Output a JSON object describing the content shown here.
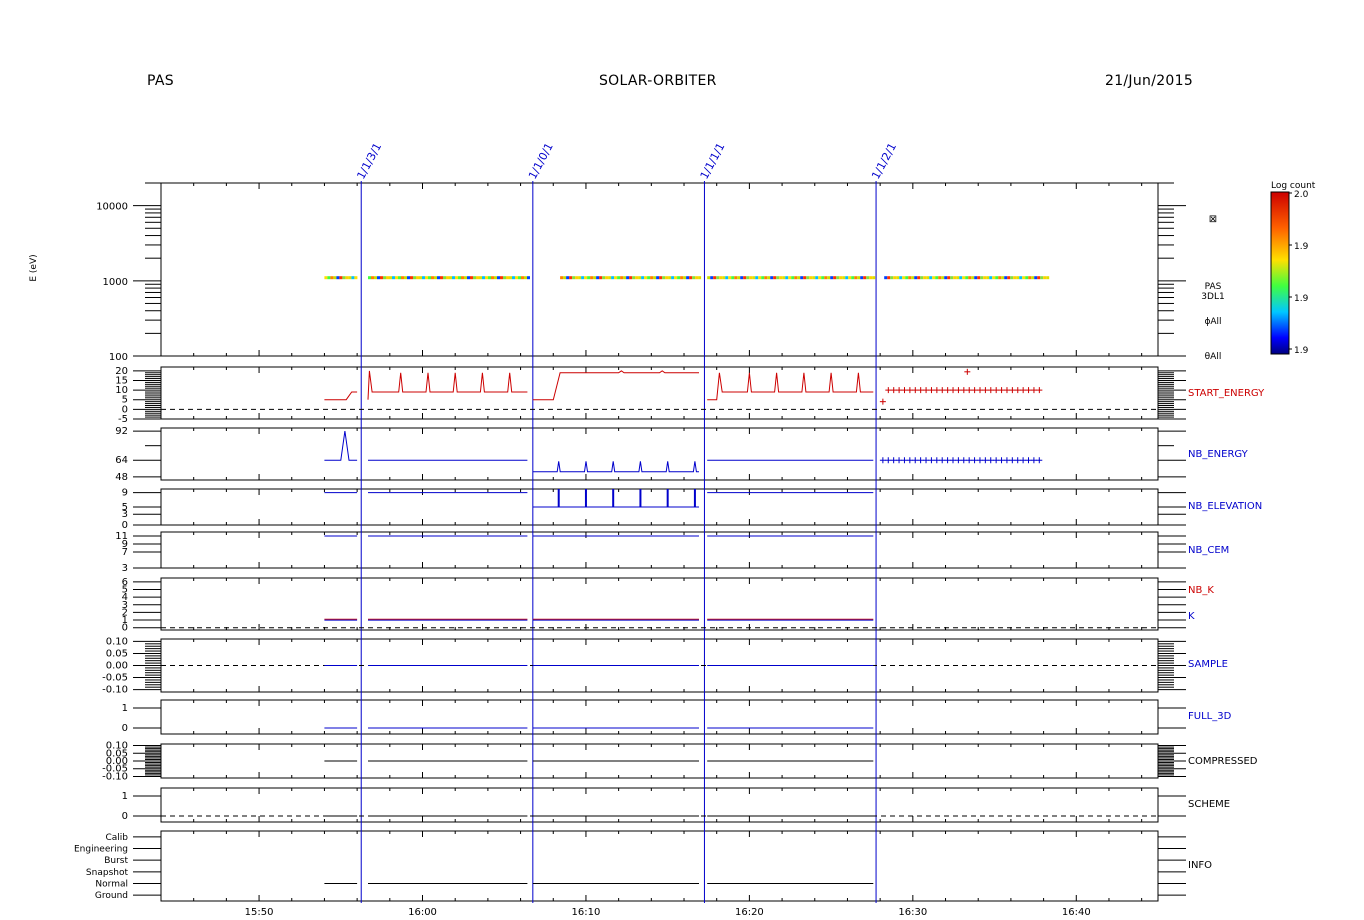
{
  "header": {
    "left": "PAS",
    "center": "SOLAR-ORBITER",
    "right": "21/Jun/2015"
  },
  "colors": {
    "blue": "#0000cc",
    "red": "#cc0000",
    "black": "#000000"
  },
  "chart_data": {
    "type": "line",
    "x_axis": {
      "range": [
        "15:44",
        "16:45"
      ],
      "ticks": [
        "15:50",
        "16:00",
        "16:10",
        "16:20",
        "16:30",
        "16:40"
      ]
    },
    "markers": [
      {
        "time": "15:56:15",
        "label": "1/1/3/1"
      },
      {
        "time": "16:06:45",
        "label": "1/1/0/1"
      },
      {
        "time": "16:17:15",
        "label": "1/1/1/1"
      },
      {
        "time": "16:27:45",
        "label": "1/1/2/1"
      }
    ],
    "spectrogram": {
      "ylabel": "E (eV)",
      "yscale": "log",
      "yticks": [
        "10000",
        "1000",
        "100"
      ],
      "ylim": [
        100,
        20000
      ],
      "right_labels": [
        "PAS",
        "3DL1",
        "ϕAll",
        "θAll"
      ],
      "colorbar": {
        "title": "Log count",
        "ticks": [
          "2.0",
          "1.9",
          "1.9",
          "1.9"
        ]
      },
      "energy_level": 1100,
      "segments": [
        [
          "15:54:00",
          "15:56:00"
        ],
        [
          "15:56:40",
          "16:06:25"
        ],
        [
          "16:08:25",
          "16:16:55"
        ],
        [
          "16:17:25",
          "16:27:35"
        ],
        [
          "16:28:15",
          "16:38:10"
        ]
      ]
    },
    "panels": [
      {
        "name": "START_ENERGY",
        "label_color": "#cc0000",
        "yticks": [
          "20",
          "15",
          "10",
          "5",
          "0",
          "-5"
        ],
        "ylim": [
          -5,
          22
        ]
      },
      {
        "name": "NB_ENERGY",
        "label_color": "#0000cc",
        "yticks": [
          "92",
          "64",
          "48"
        ],
        "ylim": [
          45,
          95
        ]
      },
      {
        "name": "NB_ELEVATION",
        "label_color": "#0000cc",
        "yticks": [
          "9",
          "5",
          "3",
          "0"
        ],
        "ylim": [
          0,
          10
        ]
      },
      {
        "name": "NB_CEM",
        "label_color": "#0000cc",
        "yticks": [
          "11",
          "9",
          "7",
          "3"
        ],
        "ylim": [
          3,
          12
        ]
      },
      {
        "name": "NB_K",
        "label_color": "#cc0000",
        "second_label": "K",
        "second_color": "#0000cc",
        "yticks": [
          "6",
          "5",
          "4",
          "3",
          "2",
          "1",
          "0"
        ],
        "ylim": [
          -0.3,
          6.5
        ]
      },
      {
        "name": "SAMPLE",
        "label_color": "#0000cc",
        "yticks": [
          "0.10",
          "0.05",
          "0.00",
          "-0.05",
          "-0.10"
        ],
        "ylim": [
          -0.11,
          0.11
        ]
      },
      {
        "name": "FULL_3D",
        "label_color": "#0000cc",
        "yticks": [
          "1",
          "0"
        ],
        "ylim": [
          -0.3,
          1.4
        ]
      },
      {
        "name": "COMPRESSED",
        "label_color": "#000000",
        "yticks": [
          "0.10",
          "0.05",
          "0.00",
          "-0.05",
          "-0.10"
        ],
        "ylim": [
          -0.11,
          0.11
        ]
      },
      {
        "name": "SCHEME",
        "label_color": "#000000",
        "yticks": [
          "1",
          "0"
        ],
        "ylim": [
          -0.3,
          1.4
        ]
      },
      {
        "name": "INFO",
        "label_color": "#000000",
        "yticks": [
          "Calib",
          "Engineering",
          "Burst",
          "Snapshot",
          "Normal",
          "Ground"
        ],
        "ylim": [
          -0.5,
          5.5
        ]
      }
    ]
  }
}
